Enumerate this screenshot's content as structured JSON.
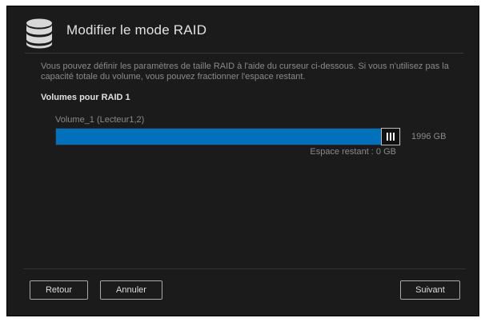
{
  "header": {
    "title": "Modifier le mode RAID",
    "icon": "database-icon"
  },
  "description": "Vous pouvez définir les paramètres de taille RAID à l'aide du curseur ci-dessous. Si vous n'utilisez pas la capacité totale du volume, vous pouvez fractionner l'espace restant.",
  "section_title": "Volumes pour RAID 1",
  "volume": {
    "label": "Volume_1 (Lecteur1,2)",
    "size_label": "1996 GB",
    "remaining_label": "Espace restant : 0 GB",
    "slider_fraction": 1.0
  },
  "buttons": {
    "back": "Retour",
    "cancel": "Annuler",
    "next": "Suivant"
  },
  "colors": {
    "background": "#1b1b1b",
    "slider_fill": "#0071ba",
    "text_muted": "#8a8a8a"
  }
}
